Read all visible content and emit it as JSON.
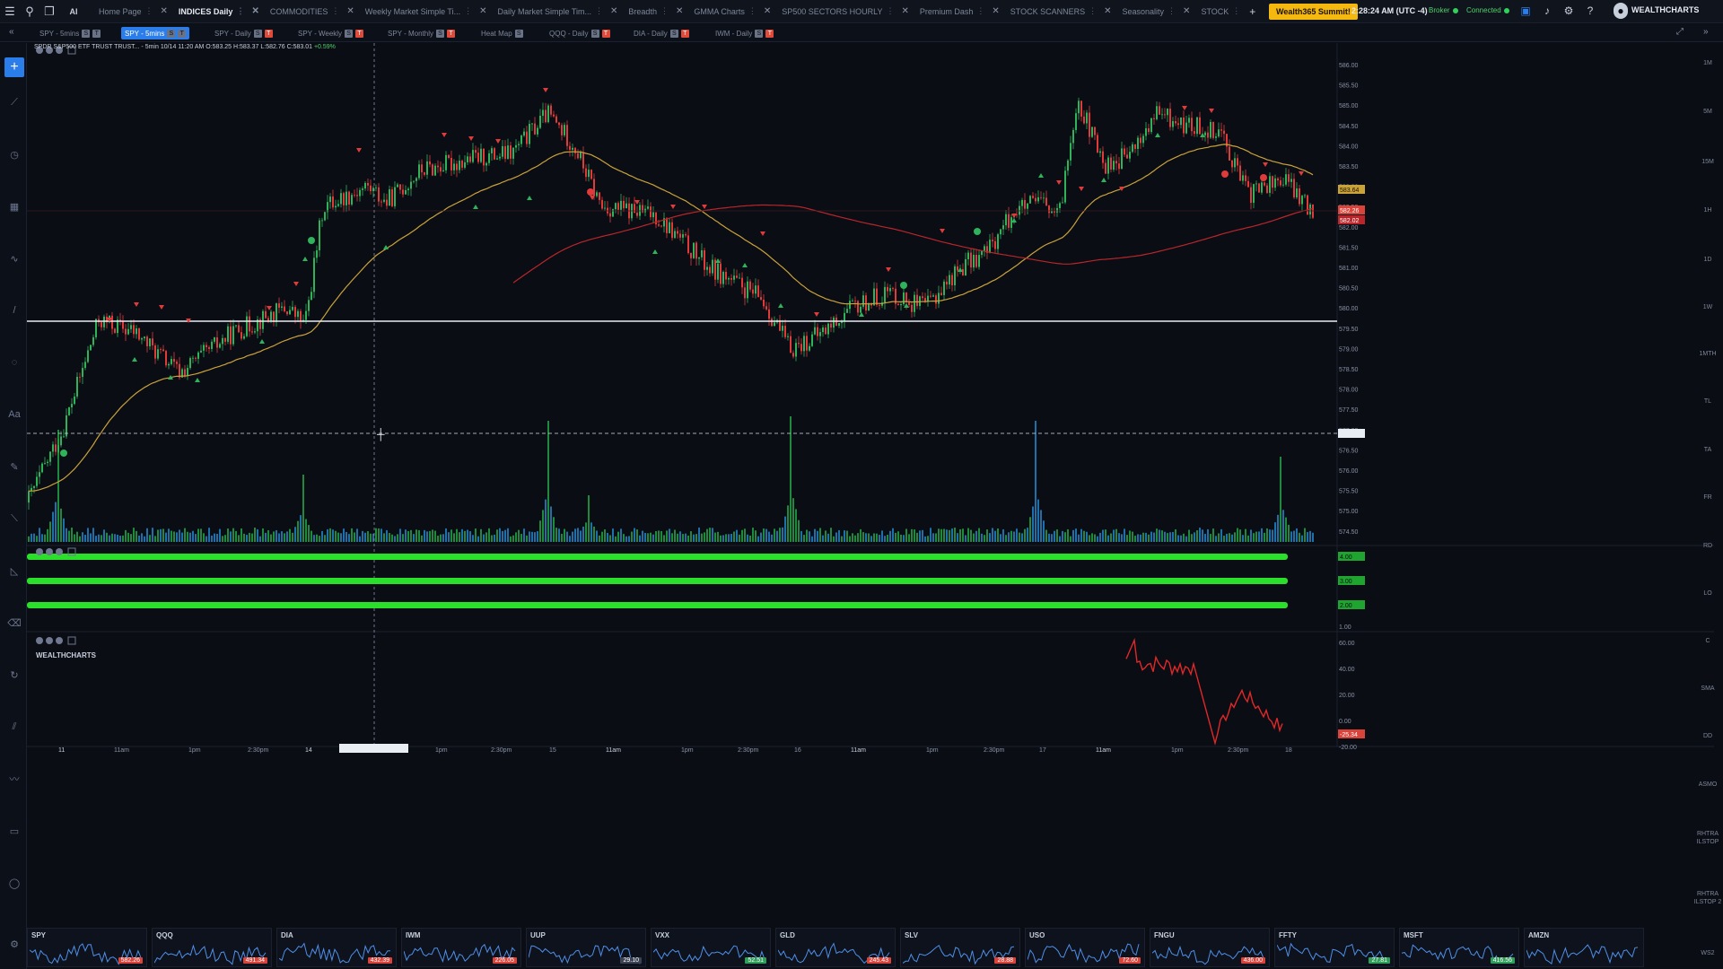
{
  "topbar": {
    "tabs": [
      {
        "label": "Home Page",
        "active": false
      },
      {
        "label": "INDICES Daily",
        "active": true
      },
      {
        "label": "COMMODITIES",
        "active": false
      },
      {
        "label": "Weekly Market Simple Ti...",
        "active": false
      },
      {
        "label": "Daily Market Simple Tim...",
        "active": false
      },
      {
        "label": "Breadth",
        "active": false
      },
      {
        "label": "GMMA Charts",
        "active": false
      },
      {
        "label": "SP500 SECTORS HOURLY",
        "active": false
      },
      {
        "label": "Premium Dash",
        "active": false
      },
      {
        "label": "STOCK SCANNERS",
        "active": false
      },
      {
        "label": "Seasonality",
        "active": false
      },
      {
        "label": "STOCK",
        "active": false
      }
    ],
    "summit_button": "Wealth365 Summit!",
    "clock": "2:28:24 AM  (UTC -4)",
    "broker": "Broker",
    "connected": "Connected",
    "brand": "WEALTHCHARTS"
  },
  "chart_tabs": [
    {
      "label": "SPY - 5mins",
      "active": false
    },
    {
      "label": "SPY - 5mins",
      "active": true
    },
    {
      "label": "SPY - Daily",
      "active": false
    },
    {
      "label": "SPY - Weekly",
      "active": false
    },
    {
      "label": "SPY - Monthly",
      "active": false
    },
    {
      "label": "Heat Map",
      "active": false
    },
    {
      "label": "QQQ - Daily",
      "active": false
    },
    {
      "label": "DIA - Daily",
      "active": false
    },
    {
      "label": "IWM - Daily",
      "active": false
    }
  ],
  "legend": {
    "text": "SPDR S&P500 ETF TRUST TRUST... - 5min  10/14 11:20 AM  O:583.25 H:583.37 L:582.76 C:583.01",
    "change": "+0.59%"
  },
  "pane_watermark": "WEALTHCHARTS",
  "price_axis": [
    "586.00",
    "585.50",
    "585.00",
    "584.50",
    "584.00",
    "583.50",
    "583.00",
    "582.50",
    "582.00",
    "581.50",
    "581.00",
    "580.50",
    "580.00",
    "579.50",
    "579.00",
    "578.50",
    "578.00",
    "577.50",
    "577.00",
    "576.50",
    "576.00",
    "575.50",
    "575.00",
    "574.50"
  ],
  "price_tags": {
    "last": "582.26",
    "sma": "582.02",
    "ema": "583.64"
  },
  "osc_tags": [
    "4.00",
    "3.00",
    "2.00"
  ],
  "osc_axis": {
    "top": "1.00"
  },
  "bottom_axis": [
    "60.00",
    "40.00",
    "20.00",
    "0.00",
    "-20.00"
  ],
  "bottom_tag": "-25.34",
  "time_axis": [
    "11",
    "11am",
    "1pm",
    "2:30pm",
    "14",
    "1pm",
    "2:30pm",
    "15",
    "11am",
    "1pm",
    "2:30pm",
    "16",
    "11am",
    "1pm",
    "2:30pm",
    "17",
    "11am",
    "1pm",
    "2:30pm",
    "18"
  ],
  "right_labels": [
    "1M",
    "5M",
    "15M",
    "1H",
    "1D",
    "1W",
    "1MTH",
    "TL",
    "TA",
    "FR",
    "RD",
    "LO",
    "C",
    "SMA",
    "DD",
    "ASMO",
    "RHTRA ILSTOP",
    "RHTRA ILSTOP 2",
    "WS2"
  ],
  "tickers": [
    {
      "name": "SPY",
      "price": "582.26",
      "dir": "down"
    },
    {
      "name": "QQQ",
      "price": "491.34",
      "dir": "down"
    },
    {
      "name": "DIA",
      "price": "432.39",
      "dir": "down"
    },
    {
      "name": "IWM",
      "price": "226.05",
      "dir": "down"
    },
    {
      "name": "UUP",
      "price": "29.10",
      "dir": "neutral"
    },
    {
      "name": "VXX",
      "price": "52.51",
      "dir": "up"
    },
    {
      "name": "GLD",
      "price": "245.43",
      "dir": "down"
    },
    {
      "name": "SLV",
      "price": "28.88",
      "dir": "down"
    },
    {
      "name": "USO",
      "price": "72.60",
      "dir": "down"
    },
    {
      "name": "FNGU",
      "price": "436.00",
      "dir": "down"
    },
    {
      "name": "FFTY",
      "price": "27.81",
      "dir": "up"
    },
    {
      "name": "MSFT",
      "price": "416.56",
      "dir": "up"
    },
    {
      "name": "AMZN",
      "price": "",
      "dir": "neutral"
    }
  ],
  "colors": {
    "bull": "#2fb35a",
    "bear": "#e03b3b",
    "ema": "#c9a23a",
    "sma": "#b8262b",
    "osc": "#2be02b",
    "bg": "#0a0d14"
  }
}
